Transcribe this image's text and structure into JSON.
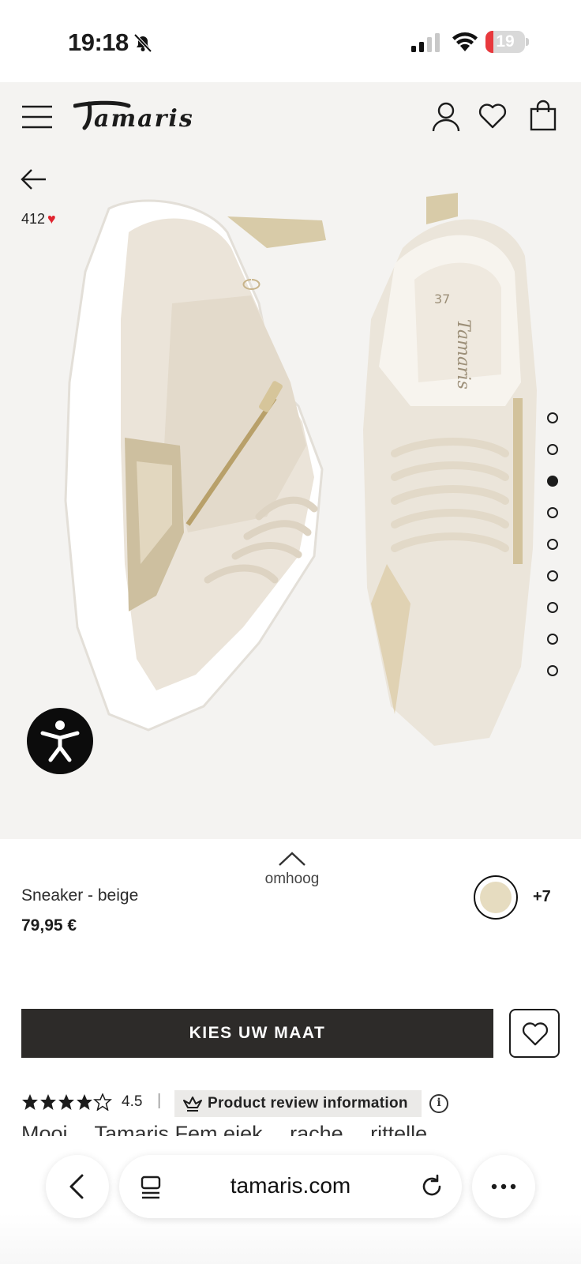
{
  "status_bar": {
    "time": "19:18",
    "battery_level": "19",
    "battery_fraction": 0.19,
    "icons": [
      "bell-off-icon",
      "signal-icon",
      "wifi-icon",
      "battery-icon"
    ]
  },
  "header": {
    "logo": "Tamaris",
    "icons": [
      "menu-icon",
      "user-icon",
      "heart-icon",
      "bag-icon"
    ]
  },
  "gallery": {
    "likes_count": "412",
    "image_count": 9,
    "active_index": 2
  },
  "product": {
    "scroll_up_label": "omhoog",
    "name": "Sneaker - beige",
    "price": "79,95 €",
    "more_colors": "+7",
    "swatch_color": "#e6dcc0",
    "size_button": "KIES UW MAAT",
    "rating_value": "4.5",
    "rating_separator": "|",
    "review_chip": "Product review information",
    "info_symbol": "i",
    "cut_off_text": "Mooi… Tamaris Fem eiek… rache… rittelle…"
  },
  "browser": {
    "url": "tamaris.com"
  },
  "colors": {
    "hero_bg": "#f4f3f1",
    "button_dark": "#2d2b29",
    "like_red": "#e0242f",
    "battery_red": "#e8393d"
  }
}
